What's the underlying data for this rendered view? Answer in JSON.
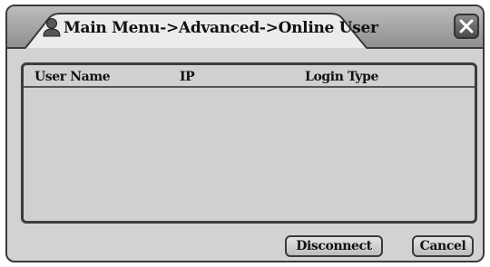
{
  "window": {
    "title": "Main Menu->Advanced->Online User",
    "title_icon": "user-icon",
    "close_icon": "close-icon"
  },
  "table": {
    "columns": [
      "User Name",
      "IP",
      "Login Type"
    ],
    "rows": []
  },
  "buttons": {
    "disconnect_label": "Disconnect",
    "cancel_label": "Cancel"
  }
}
